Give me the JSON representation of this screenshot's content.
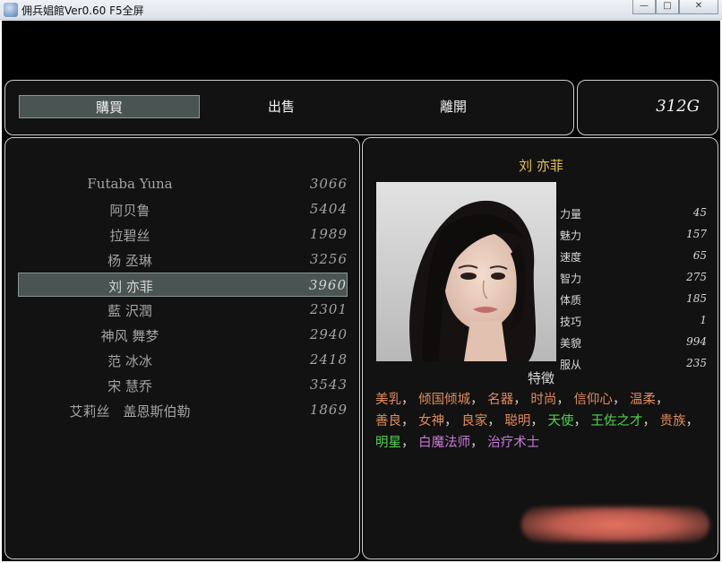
{
  "window": {
    "title": "佣兵娼館Ver0.60 F5全屏",
    "minimize_glyph": "—",
    "maximize_glyph": "□",
    "close_glyph": "✕"
  },
  "commands": {
    "buy": "購買",
    "sell": "出售",
    "leave": "離開"
  },
  "gold": "312G",
  "list": {
    "items": [
      {
        "name": "Futaba Yuna",
        "price": "3066"
      },
      {
        "name": "阿贝鲁",
        "price": "5404"
      },
      {
        "name": "拉碧丝",
        "price": "1989"
      },
      {
        "name": "杨 丞琳",
        "price": "3256"
      },
      {
        "name": "刘 亦菲",
        "price": "3960"
      },
      {
        "name": "藍 沢潤",
        "price": "2301"
      },
      {
        "name": "神风 舞梦",
        "price": "2940"
      },
      {
        "name": "范 冰冰",
        "price": "2418"
      },
      {
        "name": "宋 慧乔",
        "price": "3543"
      },
      {
        "name": "艾莉丝　盖恩斯伯勒",
        "price": "1869"
      }
    ],
    "selected_index": 4
  },
  "detail": {
    "name": "刘 亦菲",
    "stats": [
      {
        "label": "力量",
        "value": "45"
      },
      {
        "label": "魅力",
        "value": "157"
      },
      {
        "label": "速度",
        "value": "65"
      },
      {
        "label": "智力",
        "value": "275"
      },
      {
        "label": "体质",
        "value": "185"
      },
      {
        "label": "技巧",
        "value": "1"
      },
      {
        "label": "美貌",
        "value": "994"
      },
      {
        "label": "服从",
        "value": "235"
      }
    ],
    "traits_header": "特徵",
    "traits": [
      {
        "text": "美乳",
        "color": "orange"
      },
      {
        "text": "倾国倾城",
        "color": "orange"
      },
      {
        "text": "名器",
        "color": "orange"
      },
      {
        "text": "时尚",
        "color": "orange"
      },
      {
        "text": "信仰心",
        "color": "orange"
      },
      {
        "text": "温柔",
        "color": "orange"
      },
      {
        "text": "善良",
        "color": "orange"
      },
      {
        "text": "女神",
        "color": "orange"
      },
      {
        "text": "良家",
        "color": "orange"
      },
      {
        "text": "聪明",
        "color": "orange"
      },
      {
        "text": "天使",
        "color": "green"
      },
      {
        "text": "王佐之才",
        "color": "green"
      },
      {
        "text": "贵族",
        "color": "orange"
      },
      {
        "text": "明星",
        "color": "green"
      },
      {
        "text": "白魔法师",
        "color": "purple"
      },
      {
        "text": "治疗术士",
        "color": "purple"
      }
    ],
    "separator": "，"
  },
  "colors": {
    "panel_bg": "#121212",
    "selection_bg": "#4a5452",
    "name_gold": "#e6c44d",
    "trait_orange": "#e08a5a",
    "trait_green": "#4ed34e",
    "trait_purple": "#c47ad6"
  }
}
